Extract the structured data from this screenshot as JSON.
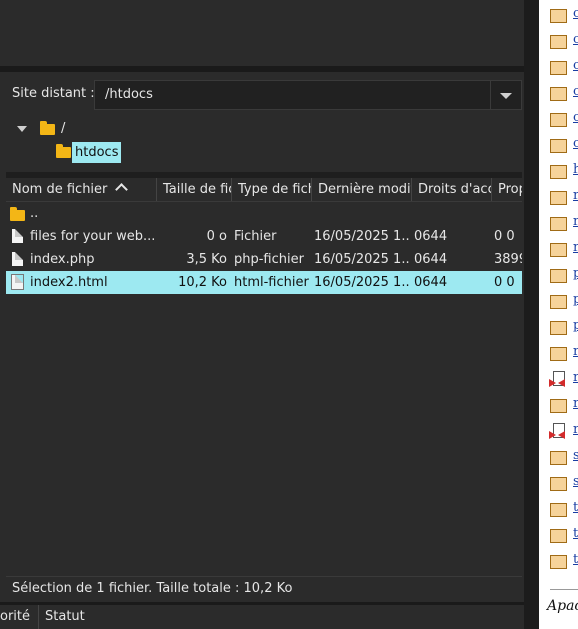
{
  "remote": {
    "label": "Site distant :",
    "path": "/htdocs"
  },
  "tree": {
    "root": "/",
    "child": "htdocs"
  },
  "columns": [
    {
      "label": "Nom de fichier"
    },
    {
      "label": "Taille de fic"
    },
    {
      "label": "Type de fich"
    },
    {
      "label": "Dernière modifi"
    },
    {
      "label": "Droits d'accè"
    },
    {
      "label": "Prop"
    }
  ],
  "files": [
    {
      "name": "..",
      "size": "",
      "type": "",
      "date": "",
      "perm": "",
      "owner": "",
      "icon": "folder-icon",
      "selected": false
    },
    {
      "name": "files for your web...",
      "size": "0 o",
      "type": "Fichier",
      "date": "16/05/2025 1...",
      "perm": "0644",
      "owner": "0 0",
      "icon": "file-icon",
      "selected": false
    },
    {
      "name": "index.php",
      "size": "3,5 Ko",
      "type": "php-fichier",
      "date": "16/05/2025 1...",
      "perm": "0644",
      "owner": "3899",
      "icon": "file-icon",
      "selected": false
    },
    {
      "name": "index2.html",
      "size": "10,2 Ko",
      "type": "html-fichier",
      "date": "16/05/2025 1...",
      "perm": "0644",
      "owner": "0 0",
      "icon": "file-icon",
      "selected": true
    }
  ],
  "status": "Sélection de 1 fichier. Taille totale : 10,2 Ko",
  "queue": {
    "col_priority": "orité",
    "col_status": "Statut"
  },
  "browser": {
    "items": [
      {
        "char": "c",
        "icon": "folder-icon"
      },
      {
        "char": "c",
        "icon": "folder-icon"
      },
      {
        "char": "c",
        "icon": "folder-icon"
      },
      {
        "char": "c",
        "icon": "folder-icon"
      },
      {
        "char": "c",
        "icon": "folder-icon"
      },
      {
        "char": "c",
        "icon": "folder-icon"
      },
      {
        "char": "h",
        "icon": "folder-icon"
      },
      {
        "char": "n",
        "icon": "folder-icon"
      },
      {
        "char": "n",
        "icon": "folder-icon"
      },
      {
        "char": "n",
        "icon": "folder-icon"
      },
      {
        "char": "p",
        "icon": "folder-icon"
      },
      {
        "char": "p",
        "icon": "folder-icon"
      },
      {
        "char": "p",
        "icon": "folder-icon"
      },
      {
        "char": "r",
        "icon": "folder-icon"
      },
      {
        "char": "r",
        "icon": "binary-file-icon"
      },
      {
        "char": "r",
        "icon": "folder-icon"
      },
      {
        "char": "r",
        "icon": "binary-file-icon"
      },
      {
        "char": "s",
        "icon": "folder-icon"
      },
      {
        "char": "s",
        "icon": "folder-icon"
      },
      {
        "char": "t",
        "icon": "folder-icon"
      },
      {
        "char": "t",
        "icon": "folder-icon"
      },
      {
        "char": "t",
        "icon": "folder-icon"
      }
    ],
    "footer": "Apac"
  },
  "colors": {
    "selection": "#9de9f1",
    "folder": "#f3b616",
    "background": "#2b2b2b"
  }
}
